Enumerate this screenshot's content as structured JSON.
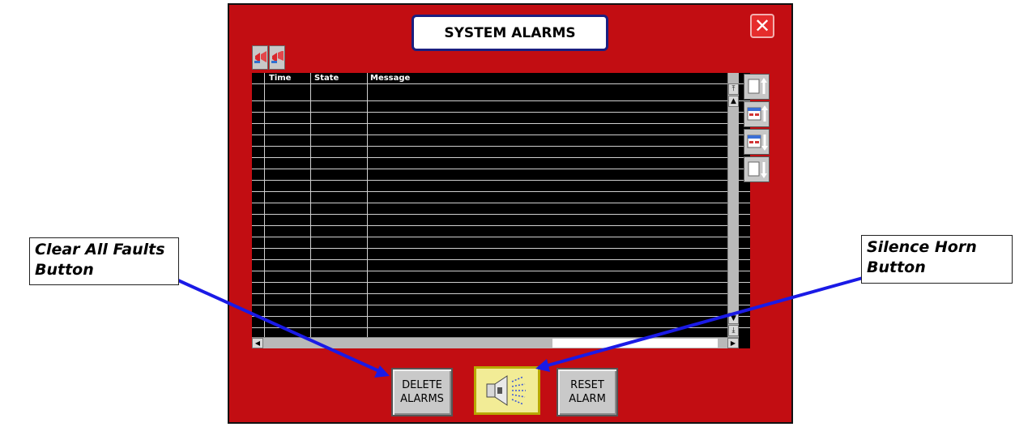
{
  "window": {
    "title": "SYSTEM ALARMS",
    "close_symbol": "✕"
  },
  "toolbar": {
    "icons": [
      "alarm-horn-red-icon",
      "alarm-horn-blue-icon"
    ]
  },
  "alarm_table": {
    "columns": [
      "Time",
      "State",
      "Message"
    ],
    "rows": []
  },
  "scrollbar": {
    "top_symbol": "⤒",
    "up_symbol": "▲",
    "down_symbol": "▼",
    "bottom_symbol": "⤓",
    "left_symbol": "◀",
    "right_symbol": "▶"
  },
  "side_buttons": [
    "page-top-icon",
    "previous-page-icon",
    "next-page-icon",
    "page-bottom-icon"
  ],
  "buttons": {
    "delete_label": "DELETE\nALARMS",
    "silence_icon": "speaker-horn-icon",
    "reset_label": "RESET\nALARM"
  },
  "annotations": {
    "clear_all": "Clear All Faults\nButton",
    "silence_horn": "Silence Horn\nButton"
  },
  "colors": {
    "panel": "#c20d12",
    "title_border": "#1b1f80",
    "arrow": "#1a1ae6",
    "silence_bg": "#f2ec96"
  }
}
